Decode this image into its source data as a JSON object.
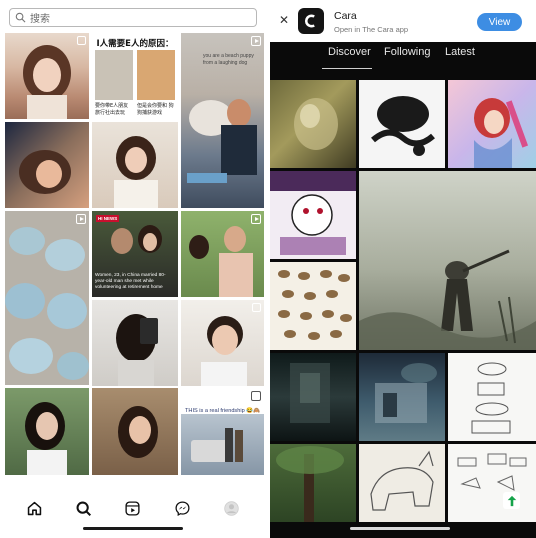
{
  "instagram": {
    "search_placeholder": "搜索",
    "tiles": {
      "text_post": {
        "title": "I人需要E人的原因：",
        "left_caption": "要你带E人朋友 旅行社出去玩",
        "right_caption": "但是会你要和 狗狗捕获游戏"
      },
      "dog_post": {
        "caption": "you are a beach puppy from a laughing dog"
      },
      "news_post": {
        "tag": "HI NEWS",
        "caption": "Women, 23, in China married 80-year-old man she met while volunteering at retirement home"
      },
      "friendship_post": {
        "caption": "THIS is a real friendship 😂🙈"
      }
    },
    "nav": [
      "home-icon",
      "search-icon",
      "reels-icon",
      "messenger-icon",
      "profile-icon"
    ]
  },
  "cara": {
    "banner": {
      "app_name": "Cara",
      "subtitle": "Open in The Cara app",
      "view_label": "View",
      "close_glyph": "✕"
    },
    "tabs": [
      {
        "label": "Discover",
        "active": true
      },
      {
        "label": "Following",
        "active": false
      },
      {
        "label": "Latest",
        "active": false
      }
    ]
  },
  "colors": {
    "cara_accent": "#3d8de3",
    "cara_background": "#0a0a0a",
    "instagram_background": "#ffffff"
  }
}
